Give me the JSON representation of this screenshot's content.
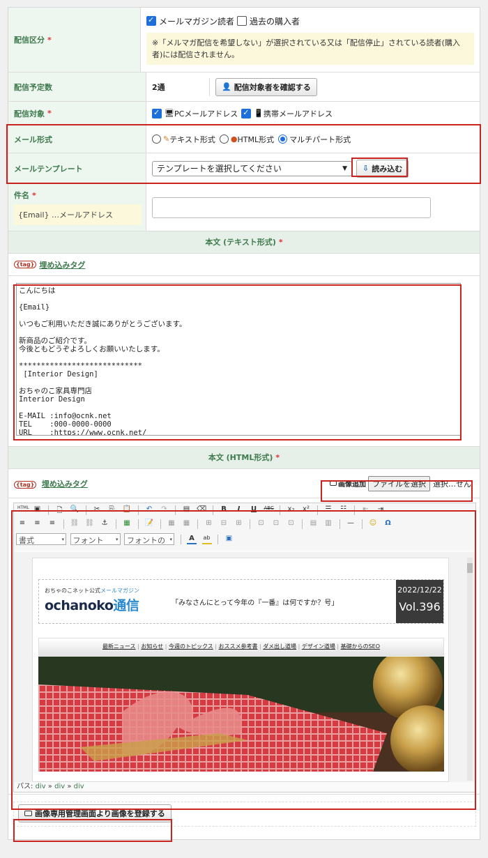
{
  "delivery_category": {
    "label": "配信区分",
    "required_mark": "*",
    "option1": "メールマガジン読者",
    "option2": "過去の購入者",
    "note": "※「メルマガ配信を希望しない」が選択されている又は「配信停止」されている読者(購入者)には配信されません。"
  },
  "scheduled_count": {
    "label": "配信予定数",
    "value": "2通",
    "confirm_button": "配信対象者を確認する"
  },
  "delivery_target": {
    "label": "配信対象",
    "required_mark": "*",
    "option_pc": "PCメールアドレス",
    "option_mobile": "携帯メールアドレス"
  },
  "mail_format": {
    "label": "メール形式",
    "option_text": "テキスト形式",
    "option_html": "HTML形式",
    "option_multipart": "マルチパート形式"
  },
  "mail_template": {
    "label": "メールテンプレート",
    "select_value": "テンプレートを選択してください",
    "load_button": "読み込む"
  },
  "subject": {
    "label": "件名",
    "required_mark": "*",
    "tag_hint": "{Email} …メールアドレス",
    "value": ""
  },
  "body_text": {
    "header": "本文 (テキスト形式)",
    "required_mark": "*",
    "embed_tag_icon": "{tag}",
    "embed_tag_link": "埋め込みタグ",
    "content": "こんにちは\n\n{Email}\n\nいつもご利用いただき誠にありがとうございます。\n\n新商品のご紹介です。\n今後ともどうぞよろしくお願いいたします。\n\n****************************\n [Interior Design]\n\nおちゃのこ家具専門店\nInterior Design\n\nE-MAIL :info@ocnk.net\nTEL    :000-0000-0000\nURL    :https://www.ocnk.net/\n****************************"
  },
  "body_html": {
    "header": "本文 (HTML形式)",
    "required_mark": "*",
    "embed_tag_icon": "{tag}",
    "embed_tag_link": "埋め込みタグ",
    "image_add_label": "画像追加",
    "file_button": "ファイルを選択",
    "file_status": "選択…せん",
    "toolbar": {
      "format_combo": "書式",
      "font_combo": "フォント",
      "size_combo": "フォントの大"
    },
    "newsletter": {
      "brand_small_prefix": "おちゃのこネット公式",
      "brand_small_highlight": "メールマガジン",
      "logo_left": "ochanoko",
      "logo_right": "通信",
      "tagline": "「みなさんにとって今年の『一番』は何ですか？号」",
      "date": "2022/12/22",
      "volume": "Vol.396",
      "nav": [
        "最新ニュース",
        "お知らせ",
        "今週のトピックス",
        "おススメ参考書",
        "ダメ出し道場",
        "デザイン道場",
        "基礎からのSEO"
      ]
    },
    "path_label": "パス:",
    "path": [
      "div",
      "div",
      "div"
    ]
  },
  "register_image_button": "画像専用管理画面より画像を登録する",
  "colors": {
    "accent_green": "#3d7a4c",
    "label_bg": "#eef6f0",
    "highlight_red": "#c8231f",
    "checkbox_blue": "#1e6fd9"
  }
}
